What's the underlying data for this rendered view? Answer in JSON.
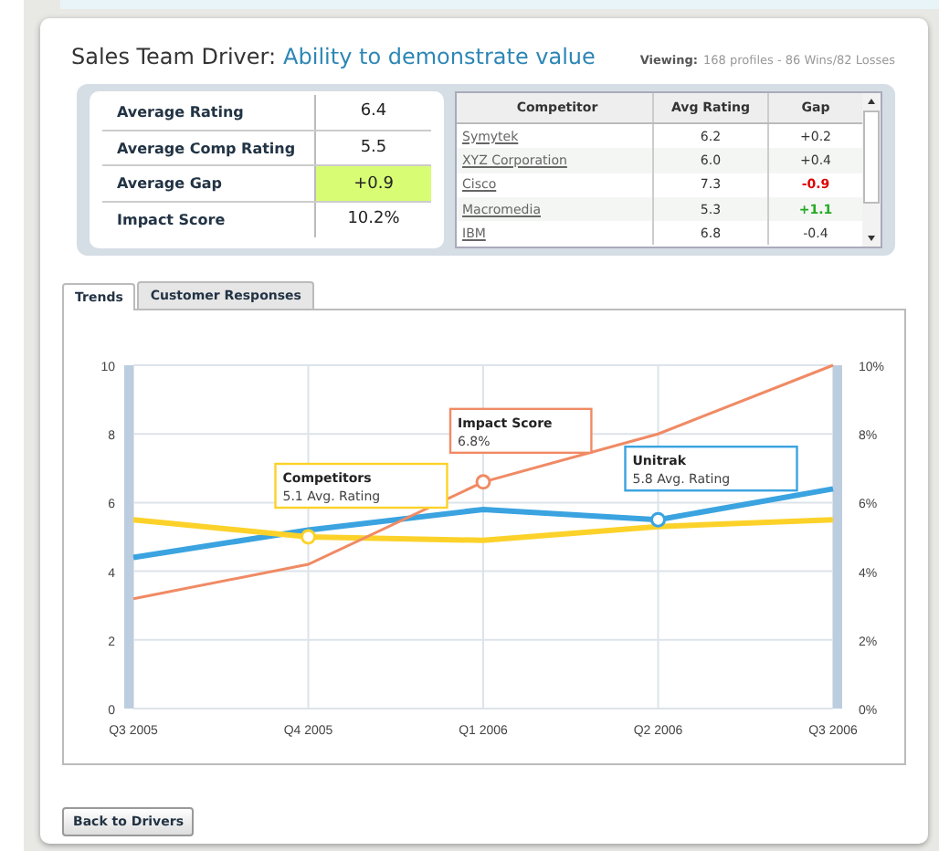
{
  "header": {
    "label": "Sales Team Driver:",
    "driver": "Ability to demonstrate value",
    "viewing_label": "Viewing:",
    "viewing_value": "168 profiles - 86 Wins/82 Losses"
  },
  "summary": [
    {
      "label": "Average Rating",
      "value": "6.4",
      "highlighted": false
    },
    {
      "label": "Average Comp Rating",
      "value": "5.5",
      "highlighted": false
    },
    {
      "label": "Average Gap",
      "value": "+0.9",
      "highlighted": true
    },
    {
      "label": "Impact Score",
      "value": "10.2%",
      "highlighted": false
    }
  ],
  "competitors": {
    "columns": [
      "Competitor",
      "Avg Rating",
      "Gap"
    ],
    "rows": [
      {
        "name": "Symytek",
        "rating": "6.2",
        "gap": "+0.2",
        "color": "#333333",
        "bold": false
      },
      {
        "name": "XYZ Corporation",
        "rating": "6.0",
        "gap": "+0.4",
        "color": "#333333",
        "bold": false
      },
      {
        "name": "Cisco",
        "rating": "7.3",
        "gap": "-0.9",
        "color": "#dd0000",
        "bold": true
      },
      {
        "name": "Macromedia",
        "rating": "5.3",
        "gap": "+1.1",
        "color": "#22aa22",
        "bold": true
      },
      {
        "name": "IBM",
        "rating": "6.8",
        "gap": "-0.4",
        "color": "#333333",
        "bold": false
      }
    ]
  },
  "tabs": [
    {
      "label": "Trends",
      "selected": true
    },
    {
      "label": "Customer Responses",
      "selected": false
    }
  ],
  "trends": {
    "chart_data": {
      "type": "line",
      "categories": [
        "Q3 2005",
        "Q4 2005",
        "Q1 2006",
        "Q2 2006",
        "Q3 2006"
      ],
      "series": [
        {
          "name": "Unitrak",
          "color": "#3aa3e0",
          "values": [
            4.4,
            5.2,
            5.8,
            5.5,
            6.4
          ]
        },
        {
          "name": "Competitors",
          "color": "#fcd22a",
          "values": [
            5.5,
            5.0,
            4.9,
            5.3,
            5.5
          ]
        },
        {
          "name": "Impact Score",
          "color": "#f08a64",
          "values": [
            3.2,
            4.2,
            6.6,
            8.0,
            10.0
          ]
        }
      ],
      "ylim": [
        0,
        10
      ],
      "yticks": [
        0,
        2,
        4,
        6,
        8,
        10
      ],
      "grid": true,
      "y2ticks": [
        "0%",
        "2%",
        "4%",
        "6%",
        "8%",
        "10%"
      ],
      "annotations": [
        {
          "x": "Q4 2005",
          "y": 5.0,
          "text": "5.1 Avg. Rating"
        },
        {
          "x": "Q1 2006",
          "y": 6.6,
          "text": "6.8%"
        },
        {
          "x": "Q2 2006",
          "y": 5.5,
          "text": "5.8 Avg. Rating"
        }
      ]
    }
  },
  "buttons": [
    "Back to Drivers"
  ]
}
